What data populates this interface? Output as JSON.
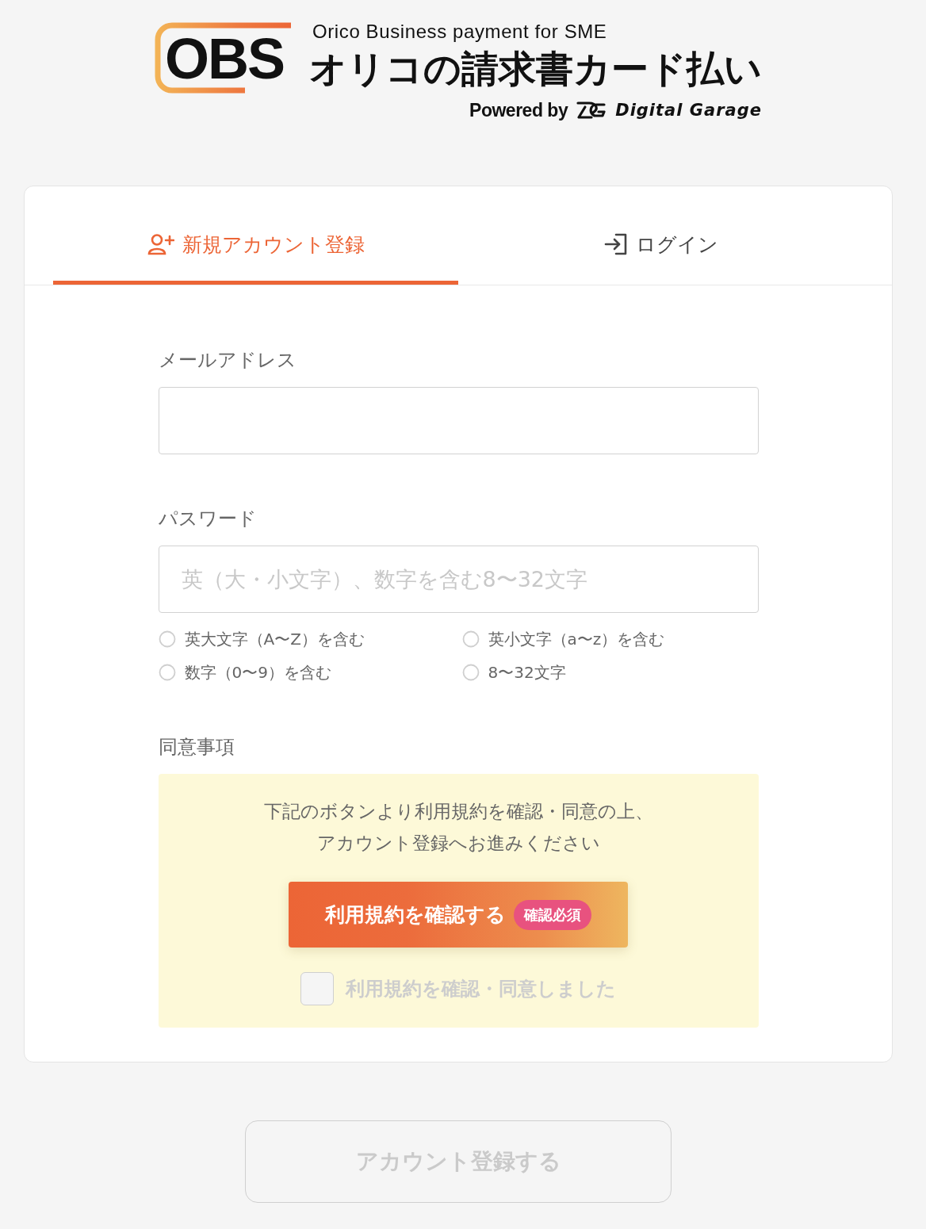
{
  "header": {
    "logo_mark": "OBS",
    "tagline": "Orico Business payment for SME",
    "service_name": "オリコの請求書カード払い",
    "powered_by": "Powered by",
    "partner": "Digital Garage"
  },
  "tabs": [
    {
      "kind": "register",
      "label": "新規アカウント登録",
      "selected": true
    },
    {
      "kind": "login",
      "label": "ログイン",
      "selected": false
    }
  ],
  "email": {
    "label": "メールアドレス"
  },
  "password": {
    "label": "パスワード",
    "placeholder": "英（大・小文字）、数字を含む8〜32文字",
    "requirements": [
      {
        "text": "英大文字（A〜Z）を含む",
        "met": false
      },
      {
        "text": "英小文字（a〜z）を含む",
        "met": false
      },
      {
        "text": "数字（0〜9）を含む",
        "met": false
      },
      {
        "text": "8〜32文字",
        "met": false
      }
    ]
  },
  "agreement": {
    "label": "同意事項",
    "notice": "下記のボタンより利用規約を確認・同意の上、アカウント登録へお進みください",
    "terms_button": {
      "label": "利用規約を確認する",
      "badge": "確認必須"
    },
    "confirm": {
      "label": "利用規約を確認・同意しました",
      "checked": false,
      "disabled": true
    }
  },
  "submit": {
    "label": "アカウント登録する",
    "disabled": true
  }
}
